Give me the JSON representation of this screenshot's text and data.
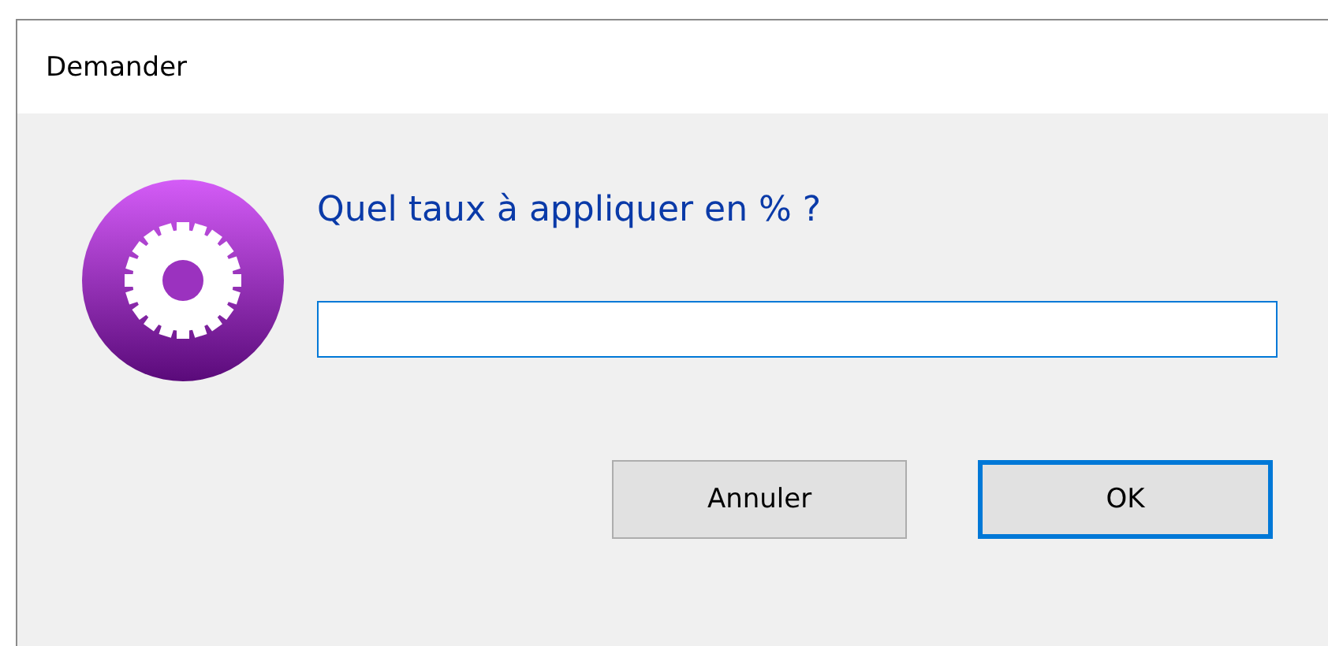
{
  "window": {
    "title": "Demander"
  },
  "prompt": {
    "question": "Quel taux à appliquer en % ?"
  },
  "buttons": [
    {
      "label": "Annuler",
      "default": false
    },
    {
      "label": "OK",
      "default": true
    }
  ]
}
